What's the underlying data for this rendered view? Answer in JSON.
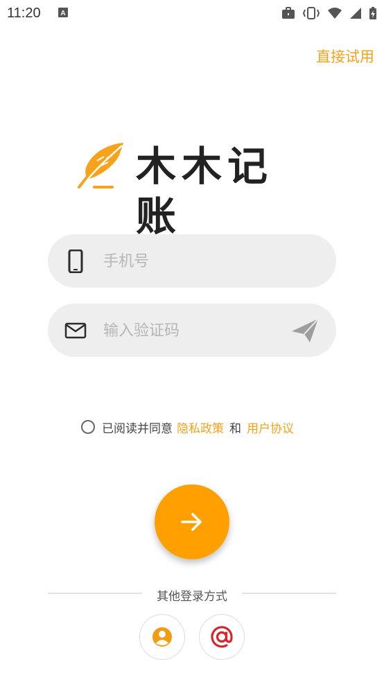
{
  "status_bar": {
    "time": "11:20",
    "icons": [
      "text-a-icon",
      "briefcase-icon",
      "vibrate-icon",
      "wifi-icon",
      "signal-icon",
      "battery-charging-icon"
    ]
  },
  "header": {
    "skip_label": "直接试用"
  },
  "logo": {
    "brand": "木木记账",
    "icon": "feather-pen-icon"
  },
  "form": {
    "phone": {
      "value": "",
      "placeholder": "手机号",
      "icon": "phone-icon"
    },
    "code": {
      "value": "",
      "placeholder": "输入验证码",
      "icon": "mail-icon",
      "send_icon": "send-icon"
    }
  },
  "agreement": {
    "prefix": "已阅读并同意",
    "privacy_label": "隐私政策",
    "conjunction": "和",
    "terms_label": "用户协议",
    "checked": false
  },
  "submit": {
    "icon": "arrow-right-icon"
  },
  "other_login": {
    "label": "其他登录方式",
    "methods": [
      {
        "name": "account",
        "icon": "user-icon",
        "color": "#F39C12"
      },
      {
        "name": "email",
        "icon": "at-icon",
        "color": "#D5262E"
      }
    ]
  },
  "colors": {
    "accent": "#FFA000",
    "link": "#F7A21B",
    "field_bg": "#EEEEEE"
  }
}
